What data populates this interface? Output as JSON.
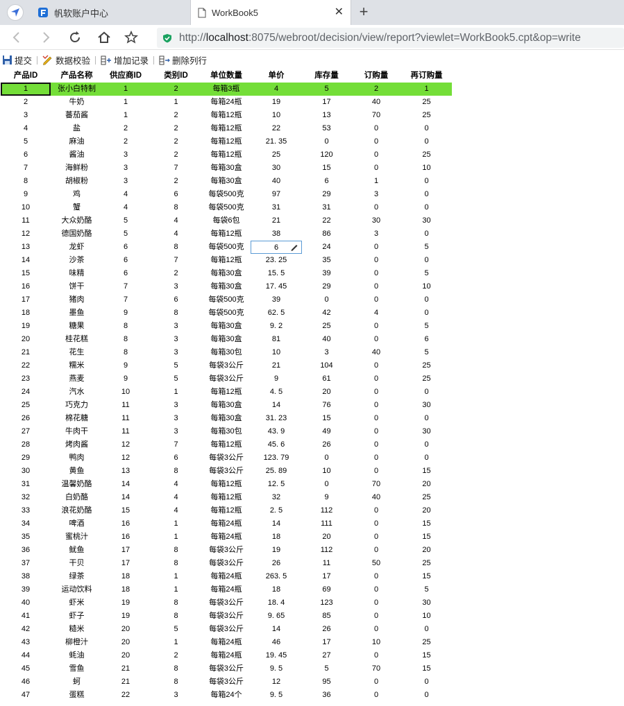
{
  "browser": {
    "tabs": [
      {
        "title": "帆软账户中心"
      },
      {
        "title": "WorkBook5"
      }
    ],
    "url": {
      "scheme": "http://",
      "host": "localhost",
      "rest": ":8075/webroot/decision/view/report?viewlet=WorkBook5.cpt&op=write"
    }
  },
  "toolbar": {
    "submit": "提交",
    "validate": "数据校验",
    "add_record": "增加记录",
    "delete_row": "删除列行"
  },
  "grid": {
    "columns": [
      "产品ID",
      "产品名称",
      "供应商ID",
      "类别ID",
      "单位数量",
      "单价",
      "库存量",
      "订购量",
      "再订购量"
    ],
    "selected_row": 0,
    "editing": {
      "row": 12,
      "col": 5
    },
    "rows": [
      [
        "1",
        "张小白特制",
        "1",
        "2",
        "每箱3瓶",
        "4",
        "5",
        "2",
        "1"
      ],
      [
        "2",
        "牛奶",
        "1",
        "1",
        "每箱24瓶",
        "19",
        "17",
        "40",
        "25"
      ],
      [
        "3",
        "蕃茄酱",
        "1",
        "2",
        "每箱12瓶",
        "10",
        "13",
        "70",
        "25"
      ],
      [
        "4",
        "盐",
        "2",
        "2",
        "每箱12瓶",
        "22",
        "53",
        "0",
        "0"
      ],
      [
        "5",
        "麻油",
        "2",
        "2",
        "每箱12瓶",
        "21. 35",
        "0",
        "0",
        "0"
      ],
      [
        "6",
        "酱油",
        "3",
        "2",
        "每箱12瓶",
        "25",
        "120",
        "0",
        "25"
      ],
      [
        "7",
        "海鲜粉",
        "3",
        "7",
        "每箱30盒",
        "30",
        "15",
        "0",
        "10"
      ],
      [
        "8",
        "胡椒粉",
        "3",
        "2",
        "每箱30盒",
        "40",
        "6",
        "1",
        "0"
      ],
      [
        "9",
        "鸡",
        "4",
        "6",
        "每袋500克",
        "97",
        "29",
        "3",
        "0"
      ],
      [
        "10",
        "蟹",
        "4",
        "8",
        "每袋500克",
        "31",
        "31",
        "0",
        "0"
      ],
      [
        "11",
        "大众奶酪",
        "5",
        "4",
        "每袋6包",
        "21",
        "22",
        "30",
        "30"
      ],
      [
        "12",
        "德国奶酪",
        "5",
        "4",
        "每箱12瓶",
        "38",
        "86",
        "3",
        "0"
      ],
      [
        "13",
        "龙虾",
        "6",
        "8",
        "每袋500克",
        "6",
        "24",
        "0",
        "5"
      ],
      [
        "14",
        "沙茶",
        "6",
        "7",
        "每箱12瓶",
        "23. 25",
        "35",
        "0",
        "0"
      ],
      [
        "15",
        "味精",
        "6",
        "2",
        "每箱30盒",
        "15. 5",
        "39",
        "0",
        "5"
      ],
      [
        "16",
        "饼干",
        "7",
        "3",
        "每箱30盒",
        "17. 45",
        "29",
        "0",
        "10"
      ],
      [
        "17",
        "猪肉",
        "7",
        "6",
        "每袋500克",
        "39",
        "0",
        "0",
        "0"
      ],
      [
        "18",
        "墨鱼",
        "9",
        "8",
        "每袋500克",
        "62. 5",
        "42",
        "4",
        "0"
      ],
      [
        "19",
        "糖果",
        "8",
        "3",
        "每箱30盒",
        "9. 2",
        "25",
        "0",
        "5"
      ],
      [
        "20",
        "桂花糕",
        "8",
        "3",
        "每箱30盒",
        "81",
        "40",
        "0",
        "6"
      ],
      [
        "21",
        "花生",
        "8",
        "3",
        "每箱30包",
        "10",
        "3",
        "40",
        "5"
      ],
      [
        "22",
        "糯米",
        "9",
        "5",
        "每袋3公斤",
        "21",
        "104",
        "0",
        "25"
      ],
      [
        "23",
        "燕麦",
        "9",
        "5",
        "每袋3公斤",
        "9",
        "61",
        "0",
        "25"
      ],
      [
        "24",
        "汽水",
        "10",
        "1",
        "每箱12瓶",
        "4. 5",
        "20",
        "0",
        "0"
      ],
      [
        "25",
        "巧克力",
        "11",
        "3",
        "每箱30盒",
        "14",
        "76",
        "0",
        "30"
      ],
      [
        "26",
        "棉花糖",
        "11",
        "3",
        "每箱30盒",
        "31. 23",
        "15",
        "0",
        "0"
      ],
      [
        "27",
        "牛肉干",
        "11",
        "3",
        "每箱30包",
        "43. 9",
        "49",
        "0",
        "30"
      ],
      [
        "28",
        "烤肉酱",
        "12",
        "7",
        "每箱12瓶",
        "45. 6",
        "26",
        "0",
        "0"
      ],
      [
        "29",
        "鸭肉",
        "12",
        "6",
        "每袋3公斤",
        "123. 79",
        "0",
        "0",
        "0"
      ],
      [
        "30",
        "黄鱼",
        "13",
        "8",
        "每袋3公斤",
        "25. 89",
        "10",
        "0",
        "15"
      ],
      [
        "31",
        "温馨奶酪",
        "14",
        "4",
        "每箱12瓶",
        "12. 5",
        "0",
        "70",
        "20"
      ],
      [
        "32",
        "白奶酪",
        "14",
        "4",
        "每箱12瓶",
        "32",
        "9",
        "40",
        "25"
      ],
      [
        "33",
        "浪花奶酪",
        "15",
        "4",
        "每箱12瓶",
        "2. 5",
        "112",
        "0",
        "20"
      ],
      [
        "34",
        "啤酒",
        "16",
        "1",
        "每箱24瓶",
        "14",
        "111",
        "0",
        "15"
      ],
      [
        "35",
        "蜜桃汁",
        "16",
        "1",
        "每箱24瓶",
        "18",
        "20",
        "0",
        "15"
      ],
      [
        "36",
        "鱿鱼",
        "17",
        "8",
        "每袋3公斤",
        "19",
        "112",
        "0",
        "20"
      ],
      [
        "37",
        "干贝",
        "17",
        "8",
        "每袋3公斤",
        "26",
        "11",
        "50",
        "25"
      ],
      [
        "38",
        "绿茶",
        "18",
        "1",
        "每箱24瓶",
        "263. 5",
        "17",
        "0",
        "15"
      ],
      [
        "39",
        "运动饮料",
        "18",
        "1",
        "每箱24瓶",
        "18",
        "69",
        "0",
        "5"
      ],
      [
        "40",
        "虾米",
        "19",
        "8",
        "每袋3公斤",
        "18. 4",
        "123",
        "0",
        "30"
      ],
      [
        "41",
        "虾子",
        "19",
        "8",
        "每袋3公斤",
        "9. 65",
        "85",
        "0",
        "10"
      ],
      [
        "42",
        "糙米",
        "20",
        "5",
        "每袋3公斤",
        "14",
        "26",
        "0",
        "0"
      ],
      [
        "43",
        "柳橙汁",
        "20",
        "1",
        "每箱24瓶",
        "46",
        "17",
        "10",
        "25"
      ],
      [
        "44",
        "蚝油",
        "20",
        "2",
        "每箱24瓶",
        "19. 45",
        "27",
        "0",
        "15"
      ],
      [
        "45",
        "雪鱼",
        "21",
        "8",
        "每袋3公斤",
        "9. 5",
        "5",
        "70",
        "15"
      ],
      [
        "46",
        "蚵",
        "21",
        "8",
        "每袋3公斤",
        "12",
        "95",
        "0",
        "0"
      ],
      [
        "47",
        "蛋糕",
        "22",
        "3",
        "每箱24个",
        "9. 5",
        "36",
        "0",
        "0"
      ]
    ]
  }
}
